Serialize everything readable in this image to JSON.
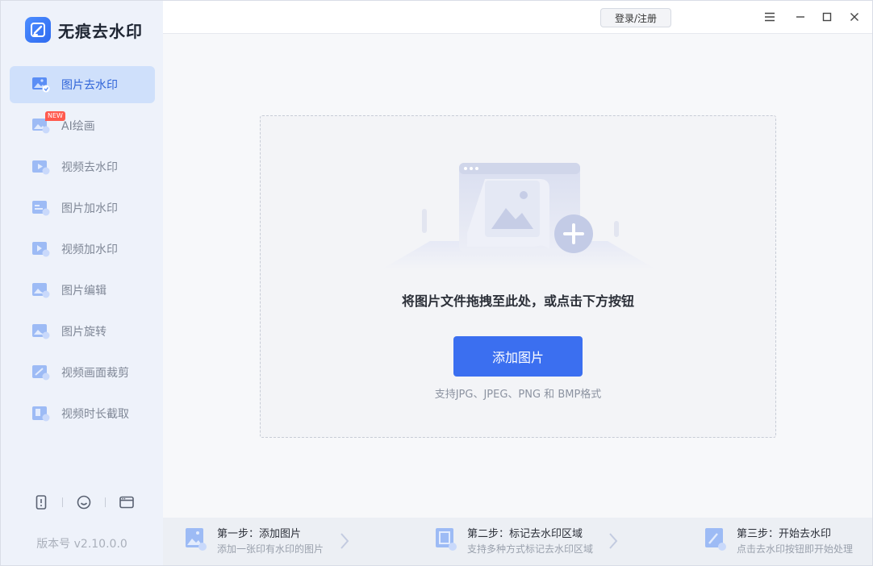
{
  "app": {
    "name": "无痕去水印",
    "version": "版本号 v2.10.0.0"
  },
  "topbar": {
    "login_label": "登录/注册"
  },
  "sidebar": {
    "items": [
      {
        "label": "图片去水印",
        "icon": "image-remove-watermark-icon",
        "active": true
      },
      {
        "label": "AI绘画",
        "icon": "ai-painting-icon",
        "badge": "NEW"
      },
      {
        "label": "视频去水印",
        "icon": "video-remove-watermark-icon"
      },
      {
        "label": "图片加水印",
        "icon": "image-add-watermark-icon"
      },
      {
        "label": "视频加水印",
        "icon": "video-add-watermark-icon"
      },
      {
        "label": "图片编辑",
        "icon": "image-edit-icon"
      },
      {
        "label": "图片旋转",
        "icon": "image-rotate-icon"
      },
      {
        "label": "视频画面裁剪",
        "icon": "video-crop-icon"
      },
      {
        "label": "视频时长截取",
        "icon": "video-trim-icon"
      }
    ]
  },
  "dropzone": {
    "prompt": "将图片文件拖拽至此处，或点击下方按钮",
    "button_label": "添加图片",
    "formats": "支持JPG、JPEG、PNG 和 BMP格式"
  },
  "steps": [
    {
      "title": "第一步：添加图片",
      "desc": "添加一张印有水印的图片"
    },
    {
      "title": "第二步：标记去水印区域",
      "desc": "支持多种方式标记去水印区域"
    },
    {
      "title": "第三步：开始去水印",
      "desc": "点击去水印按钮即开始处理"
    }
  ],
  "colors": {
    "accent": "#3b6ff0",
    "sidebar_bg": "#eef2fa",
    "active_bg": "#cfe0fb",
    "badge": "#ff5a4e"
  }
}
